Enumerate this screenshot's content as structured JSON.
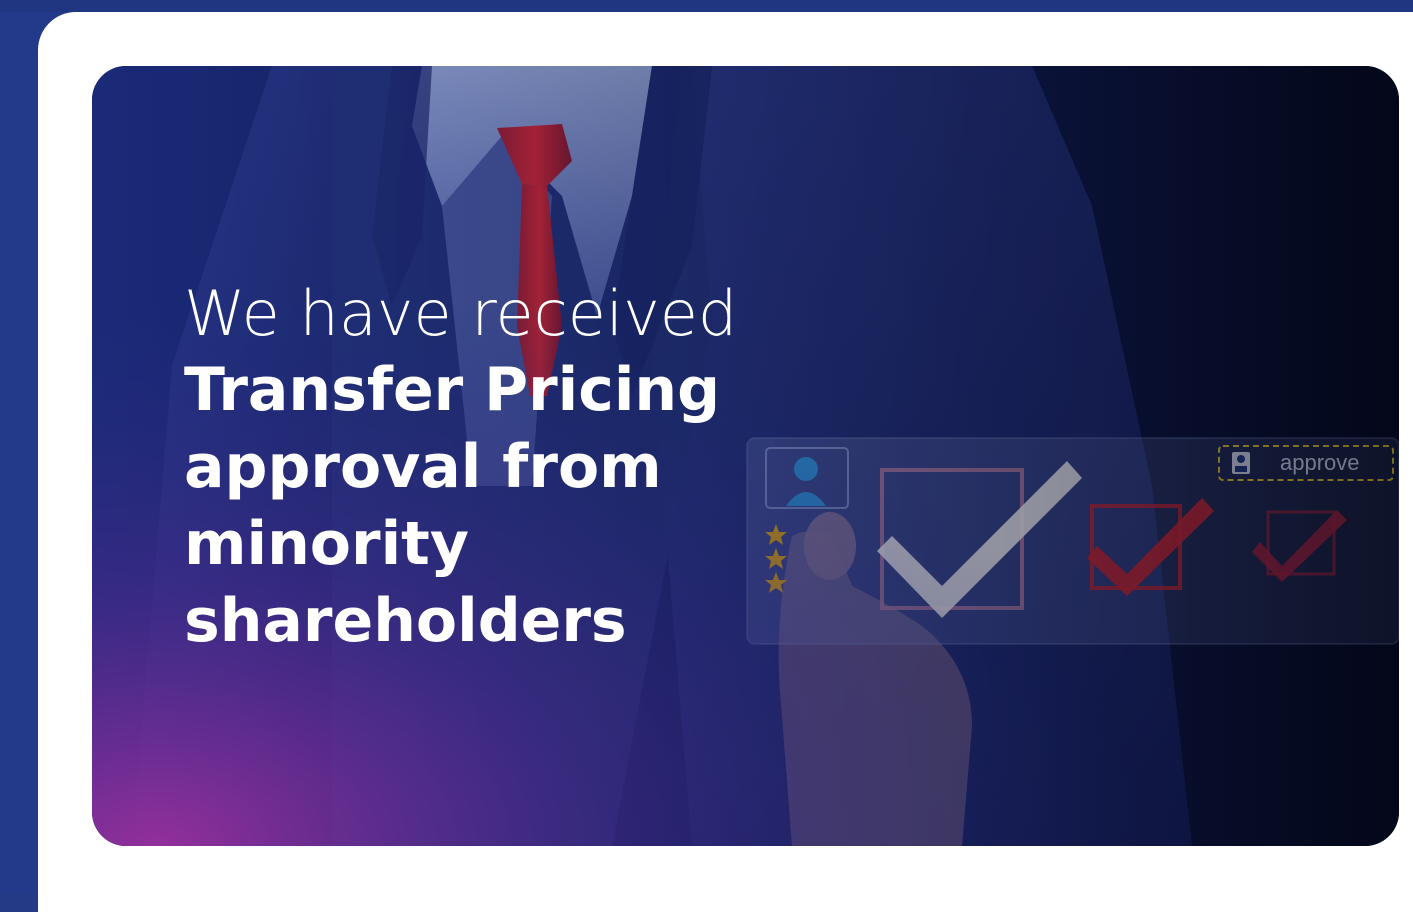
{
  "headline": {
    "line1": "We have received",
    "line2": "Transfer Pricing",
    "line3": "approval from",
    "line4": "minority",
    "line5": "shareholders"
  },
  "overlay_ui": {
    "approve_label": "approve",
    "icons": [
      "user-icon",
      "checkbox-checked-icon",
      "checkbox-checked-icon",
      "checkbox-checked-icon",
      "star-icon"
    ]
  },
  "colors": {
    "frame": "#23398a",
    "card": "#ffffff",
    "panel_dark": "#0b1540",
    "tie_red": "#b0243c",
    "accent_purple": "#8a2a9a"
  }
}
